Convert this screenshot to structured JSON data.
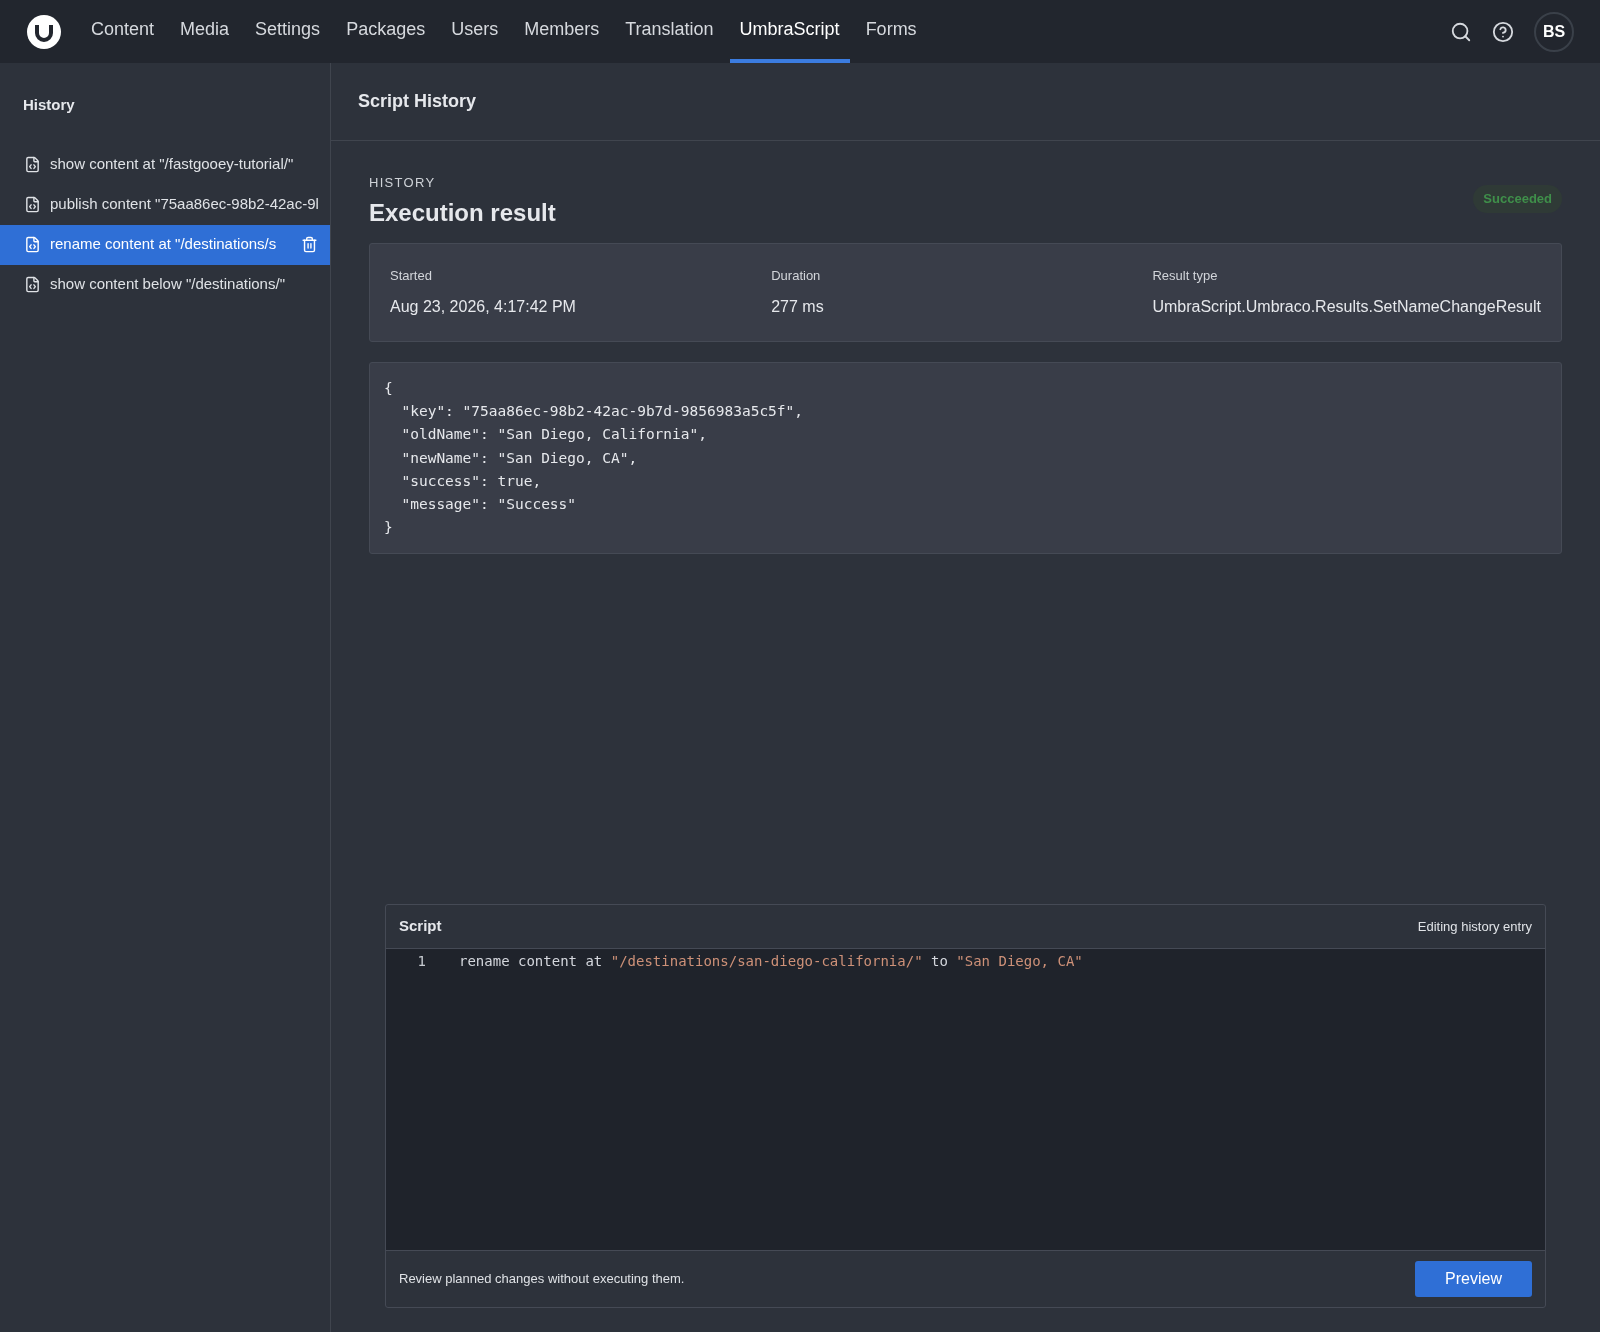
{
  "nav": {
    "tabs": [
      {
        "label": "Content",
        "selected": false
      },
      {
        "label": "Media",
        "selected": false
      },
      {
        "label": "Settings",
        "selected": false
      },
      {
        "label": "Packages",
        "selected": false
      },
      {
        "label": "Users",
        "selected": false
      },
      {
        "label": "Members",
        "selected": false
      },
      {
        "label": "Translation",
        "selected": false
      },
      {
        "label": "UmbraScript",
        "selected": true
      },
      {
        "label": "Forms",
        "selected": false
      }
    ],
    "avatar": "BS"
  },
  "sidebar": {
    "title": "History",
    "items": [
      {
        "label": "show content at \"/fastgooey-tutorial/\"",
        "selected": false
      },
      {
        "label": "publish content \"75aa86ec-98b2-42ac-9l",
        "selected": false
      },
      {
        "label": "rename content at \"/destinations/s",
        "selected": true
      },
      {
        "label": "show content below \"/destinations/\"",
        "selected": false
      }
    ]
  },
  "header": {
    "title": "Script History"
  },
  "result": {
    "eyebrow": "HISTORY",
    "title": "Execution result",
    "status": "Succeeded",
    "fields": [
      {
        "label": "Started",
        "value": "Aug 23, 2026, 4:17:42 PM"
      },
      {
        "label": "Duration",
        "value": "277 ms"
      },
      {
        "label": "Result type",
        "value": "UmbraScript.Umbraco.Results.SetNameChangeResult"
      }
    ],
    "output": [
      "{",
      "  \"key\": \"75aa86ec-98b2-42ac-9b7d-9856983a5c5f\",",
      "  \"oldName\": \"San Diego, California\",",
      "  \"newName\": \"San Diego, CA\",",
      "  \"success\": true,",
      "  \"message\": \"Success\"",
      "}"
    ]
  },
  "script": {
    "title": "Script",
    "mode": "Editing history entry",
    "lines": [
      {
        "number": "1",
        "tokens": [
          {
            "kind": "plain",
            "text": "rename content at "
          },
          {
            "kind": "string",
            "text": "\"/destinations/san-diego-california/\""
          },
          {
            "kind": "plain",
            "text": " to "
          },
          {
            "kind": "string",
            "text": "\"San Diego, CA\""
          }
        ]
      }
    ],
    "hint": "Review planned changes without executing them.",
    "button": "Preview"
  }
}
